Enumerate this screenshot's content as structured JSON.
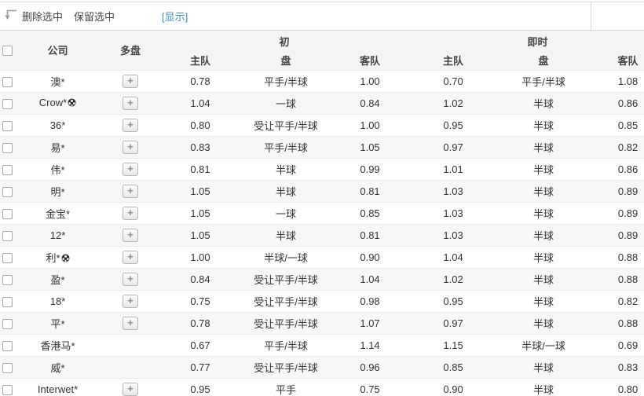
{
  "toolbar": {
    "delete_selected": "删除选中",
    "keep_selected": "保留选中",
    "show_link": "[显示]"
  },
  "table": {
    "plus_label": "+",
    "header": {
      "company": "公司",
      "multi": "多盘",
      "initial_group": "初",
      "live_group": "即时",
      "home": "主队",
      "handicap": "盘",
      "away": "客队"
    }
  },
  "colors": {
    "link_blue": "#3d8fce",
    "header_bg": "#f4f4f4",
    "row_alt_bg": "#f7f7f7",
    "text": "#333333",
    "border": "#d6d6d6"
  },
  "rows": [
    {
      "company": "澳*",
      "ball": false,
      "plus": true,
      "init_home": "0.78",
      "init_line": "平手/半球",
      "init_away": "1.00",
      "live_home": "0.70",
      "live_line": "平手/半球",
      "live_away": "1.08"
    },
    {
      "company": "Crow*",
      "ball": true,
      "plus": true,
      "init_home": "1.04",
      "init_line": "一球",
      "init_away": "0.84",
      "live_home": "1.02",
      "live_line": "半球",
      "live_away": "0.86"
    },
    {
      "company": "36*",
      "ball": false,
      "plus": true,
      "init_home": "0.80",
      "init_line": "受让平手/半球",
      "init_away": "1.00",
      "live_home": "0.95",
      "live_line": "半球",
      "live_away": "0.85"
    },
    {
      "company": "易*",
      "ball": false,
      "plus": true,
      "init_home": "0.83",
      "init_line": "平手/半球",
      "init_away": "1.05",
      "live_home": "0.97",
      "live_line": "半球",
      "live_away": "0.82"
    },
    {
      "company": "伟*",
      "ball": false,
      "plus": true,
      "init_home": "0.81",
      "init_line": "半球",
      "init_away": "0.99",
      "live_home": "1.01",
      "live_line": "半球",
      "live_away": "0.86"
    },
    {
      "company": "明*",
      "ball": false,
      "plus": true,
      "init_home": "1.05",
      "init_line": "半球",
      "init_away": "0.81",
      "live_home": "1.03",
      "live_line": "半球",
      "live_away": "0.89"
    },
    {
      "company": "金宝*",
      "ball": false,
      "plus": true,
      "init_home": "1.05",
      "init_line": "一球",
      "init_away": "0.85",
      "live_home": "1.03",
      "live_line": "半球",
      "live_away": "0.89"
    },
    {
      "company": "12*",
      "ball": false,
      "plus": true,
      "init_home": "1.05",
      "init_line": "半球",
      "init_away": "0.81",
      "live_home": "1.03",
      "live_line": "半球",
      "live_away": "0.89"
    },
    {
      "company": "利*",
      "ball": true,
      "plus": true,
      "init_home": "1.00",
      "init_line": "半球/一球",
      "init_away": "0.90",
      "live_home": "1.04",
      "live_line": "半球",
      "live_away": "0.88"
    },
    {
      "company": "盈*",
      "ball": false,
      "plus": true,
      "init_home": "0.84",
      "init_line": "受让平手/半球",
      "init_away": "1.04",
      "live_home": "1.02",
      "live_line": "半球",
      "live_away": "0.88"
    },
    {
      "company": "18*",
      "ball": false,
      "plus": true,
      "init_home": "0.75",
      "init_line": "受让平手/半球",
      "init_away": "0.98",
      "live_home": "0.95",
      "live_line": "半球",
      "live_away": "0.82"
    },
    {
      "company": "平*",
      "ball": false,
      "plus": true,
      "init_home": "0.78",
      "init_line": "受让平手/半球",
      "init_away": "1.07",
      "live_home": "0.97",
      "live_line": "半球",
      "live_away": "0.88"
    },
    {
      "company": "香港马*",
      "ball": false,
      "plus": false,
      "init_home": "0.67",
      "init_line": "平手/半球",
      "init_away": "1.14",
      "live_home": "1.15",
      "live_line": "半球/一球",
      "live_away": "0.69"
    },
    {
      "company": "威*",
      "ball": false,
      "plus": false,
      "init_home": "0.77",
      "init_line": "受让平手/半球",
      "init_away": "0.96",
      "live_home": "0.85",
      "live_line": "半球",
      "live_away": "0.83"
    },
    {
      "company": "Interwet*",
      "ball": false,
      "plus": true,
      "init_home": "0.95",
      "init_line": "平手",
      "init_away": "0.75",
      "live_home": "0.90",
      "live_line": "半球",
      "live_away": "0.80"
    }
  ]
}
